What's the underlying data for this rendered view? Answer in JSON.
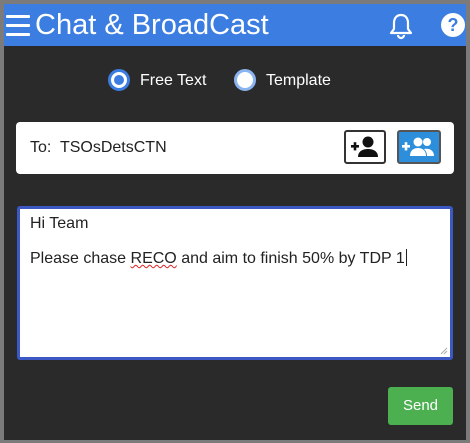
{
  "header": {
    "title": "Chat & BroadCast",
    "icons": [
      "menu-icon",
      "bell-icon",
      "help-icon"
    ],
    "help_glyph": "?"
  },
  "mode": {
    "options": [
      {
        "label": "Free Text",
        "selected": true
      },
      {
        "label": "Template",
        "selected": false
      }
    ]
  },
  "recipient": {
    "label": "To:",
    "value": "TSOsDetsCTN",
    "icons": [
      "add-person-icon",
      "add-group-icon"
    ]
  },
  "message": {
    "line1": "Hi Team",
    "line2_before": "Please chase ",
    "line2_flagged": "RECO",
    "line2_after": " and aim to finish 50% by TDP 1"
  },
  "actions": {
    "send_label": "Send"
  },
  "colors": {
    "accent": "#3b7de0",
    "background": "#2a2a2a",
    "send": "#4caf50",
    "group_button": "#2d8fdb"
  }
}
